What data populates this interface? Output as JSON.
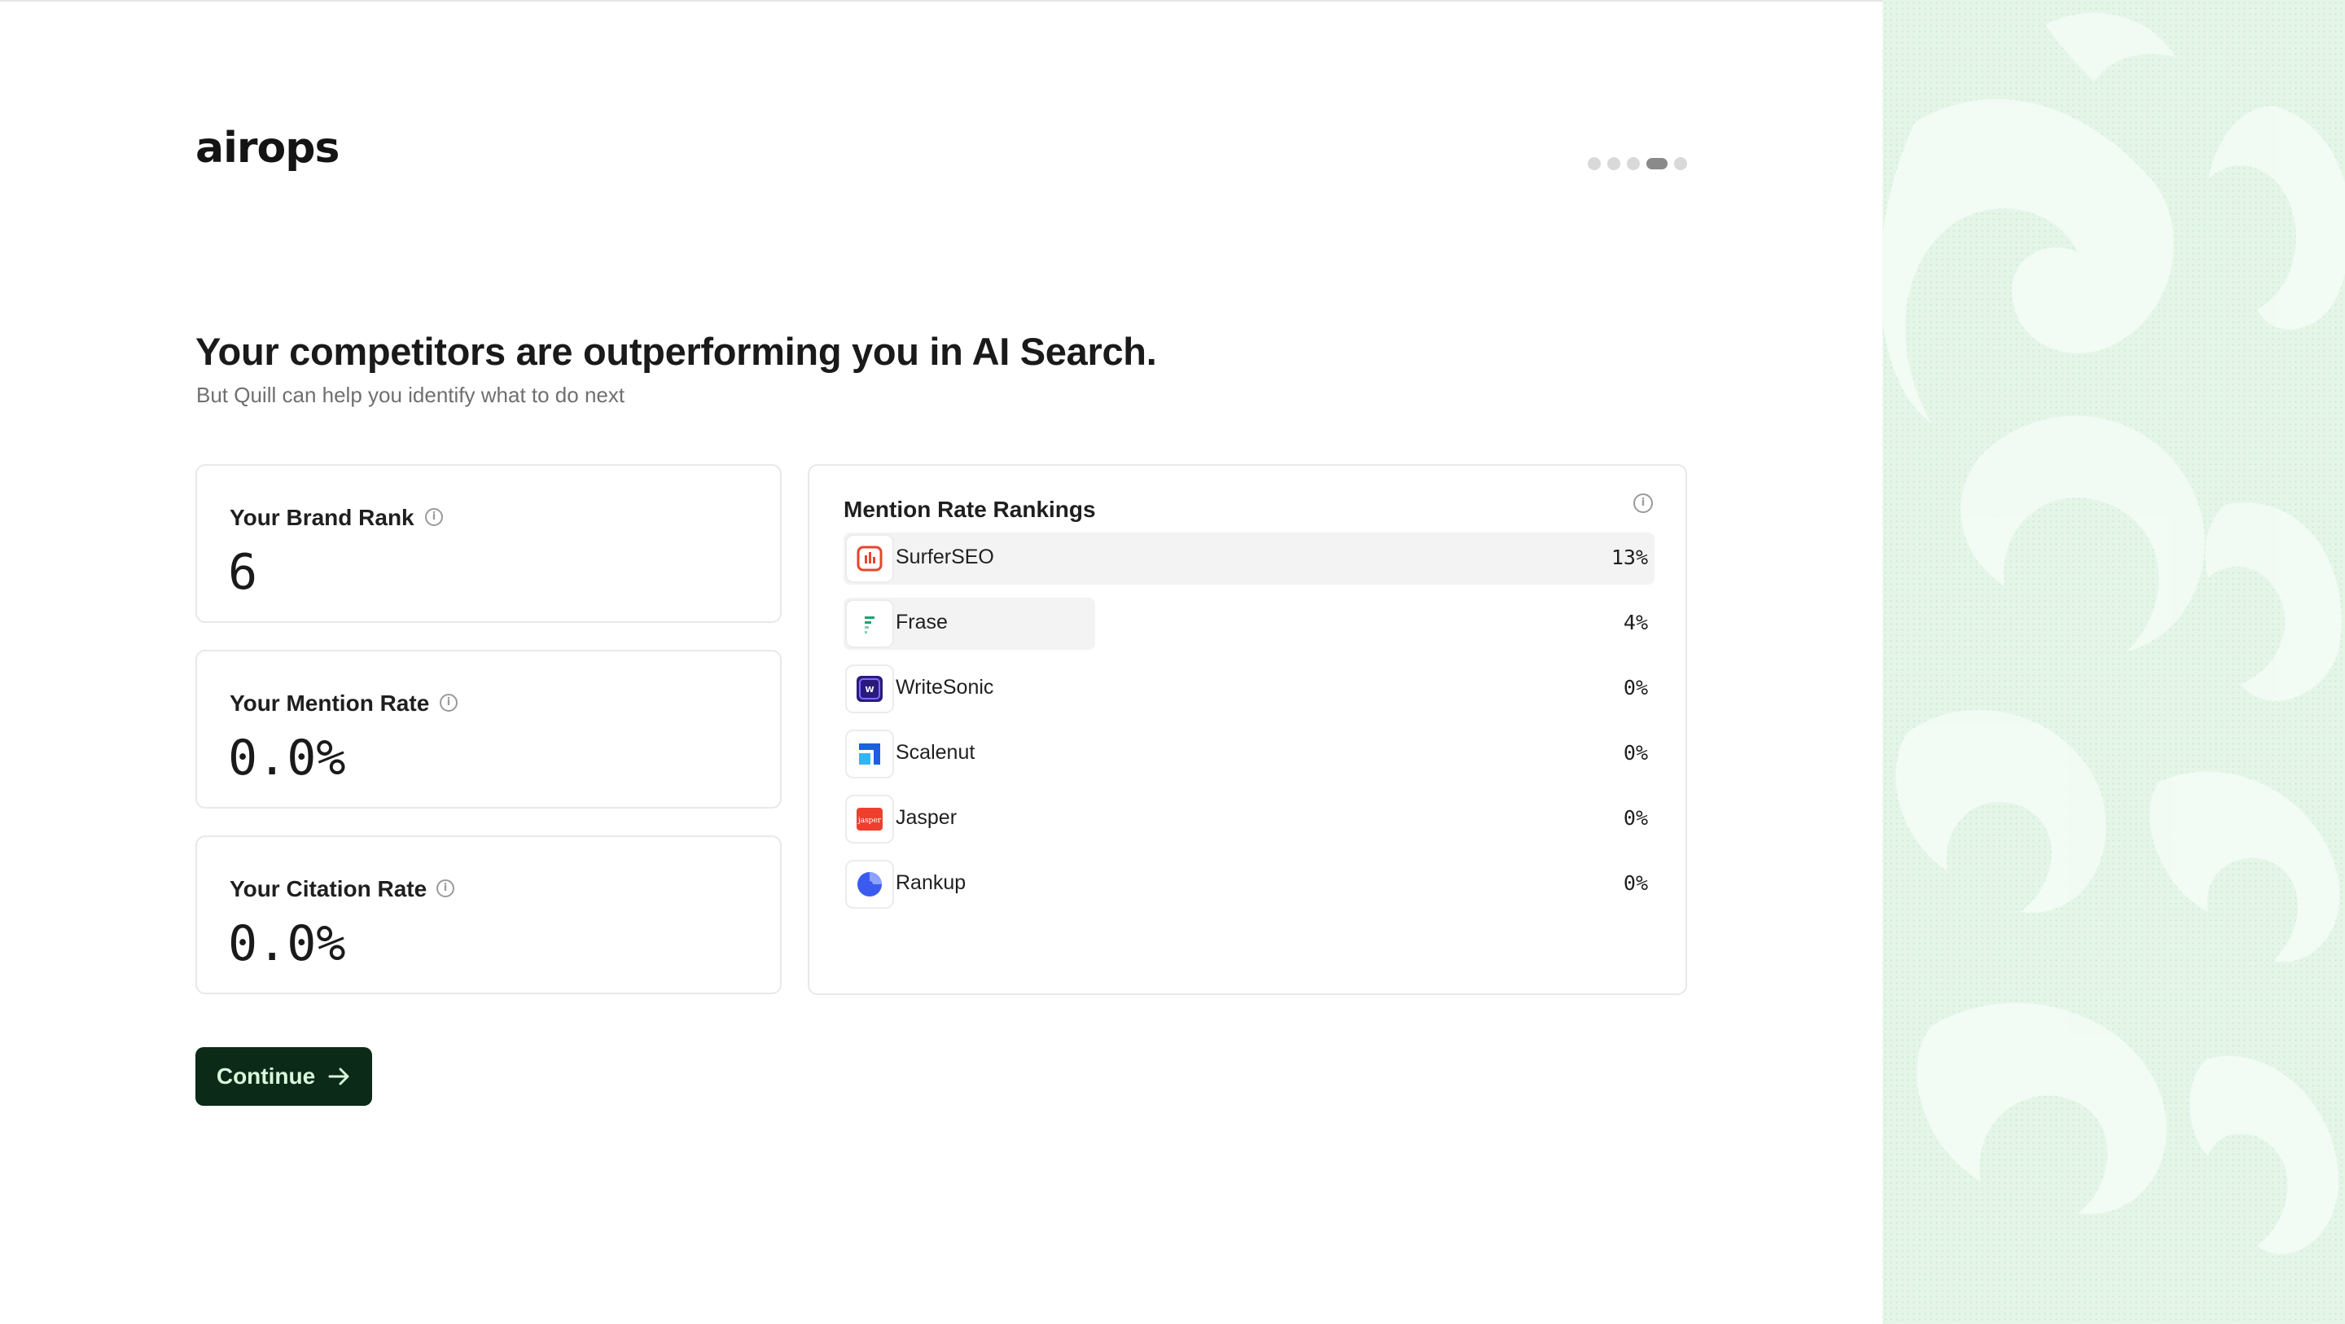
{
  "brand": {
    "logo_text": "airops"
  },
  "progress": {
    "total": 5,
    "active_index": 3
  },
  "header": {
    "title": "Your competitors are outperforming you in AI Search.",
    "subtitle": "But Quill can help you identify what to do next"
  },
  "metrics": [
    {
      "label": "Your Brand Rank",
      "value": "6"
    },
    {
      "label": "Your Mention Rate",
      "value": "0.0%"
    },
    {
      "label": "Your Citation Rate",
      "value": "0.0%"
    }
  ],
  "rankings": {
    "title": "Mention Rate Rankings",
    "rows": [
      {
        "name": "SurferSEO",
        "pct": "13%",
        "share": 1.0,
        "icon": "surferseo-logo-icon",
        "color": "#e8452c"
      },
      {
        "name": "Frase",
        "pct": "4%",
        "share": 0.31,
        "icon": "frase-logo-icon",
        "color": "#1aa36f"
      },
      {
        "name": "WriteSonic",
        "pct": "0%",
        "share": 0,
        "icon": "writesonic-logo-icon",
        "color": "#2a1b7a"
      },
      {
        "name": "Scalenut",
        "pct": "0%",
        "share": 0,
        "icon": "scalenut-logo-icon",
        "color": "#1c5fe0"
      },
      {
        "name": "Jasper",
        "pct": "0%",
        "share": 0,
        "icon": "jasper-logo-icon",
        "color": "#ee3f2e",
        "logo_text": "jasper"
      },
      {
        "name": "Rankup",
        "pct": "0%",
        "share": 0,
        "icon": "rankup-logo-icon",
        "color": "#3b5bf0"
      }
    ]
  },
  "continue_button": {
    "label": "Continue",
    "icon": "arrow-right-icon"
  },
  "colors": {
    "accent": "#0b2a17",
    "accent_text": "#d9f7dc",
    "side_panel": "#e5f6e9"
  }
}
